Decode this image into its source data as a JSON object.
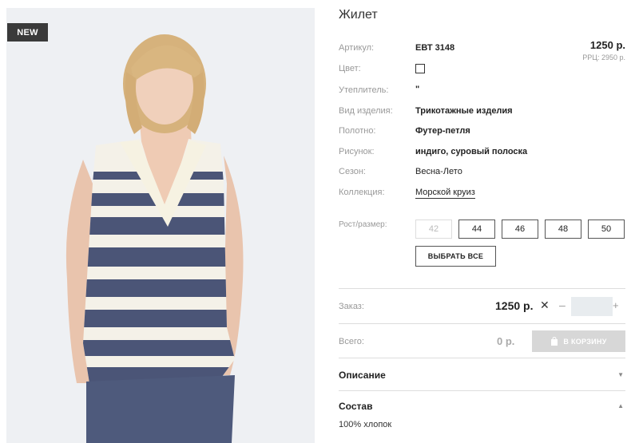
{
  "product": {
    "badge": "NEW",
    "title": "Жилет",
    "price": "1250 р.",
    "rrp": "РРЦ: 2950 р."
  },
  "specs": [
    {
      "label": "Артикул:",
      "value": "ЕВТ 3148"
    },
    {
      "label": "Цвет:",
      "value": ""
    },
    {
      "label": "Утеплитель:",
      "value": "\""
    },
    {
      "label": "Вид изделия:",
      "value": "Трикотажные изделия"
    },
    {
      "label": "Полотно:",
      "value": "Футер-петля"
    },
    {
      "label": "Рисунок:",
      "value": "индиго, суровый полоска"
    },
    {
      "label": "Сезон:",
      "value": "Весна-Лето"
    },
    {
      "label": "Коллекция:",
      "value": "Морской круиз"
    }
  ],
  "sizes": {
    "label": "Рост/размер:",
    "options": [
      "42",
      "44",
      "46",
      "48",
      "50"
    ],
    "select_all": "ВЫБРАТЬ ВСЕ"
  },
  "order": {
    "label": "Заказ:",
    "price": "1250 р.",
    "times": "✕",
    "minus": "–",
    "plus": "+",
    "quantity": ""
  },
  "total": {
    "label": "Всего:",
    "value": "0 р.",
    "cart_button": "В КОРЗИНУ"
  },
  "sections": {
    "description": "Описание",
    "composition": "Состав",
    "composition_text": "100% хлопок"
  },
  "icons": {
    "cart": "bag-icon",
    "chevron_down": "chevron-down-icon",
    "chevron_up": "chevron-up-icon"
  }
}
